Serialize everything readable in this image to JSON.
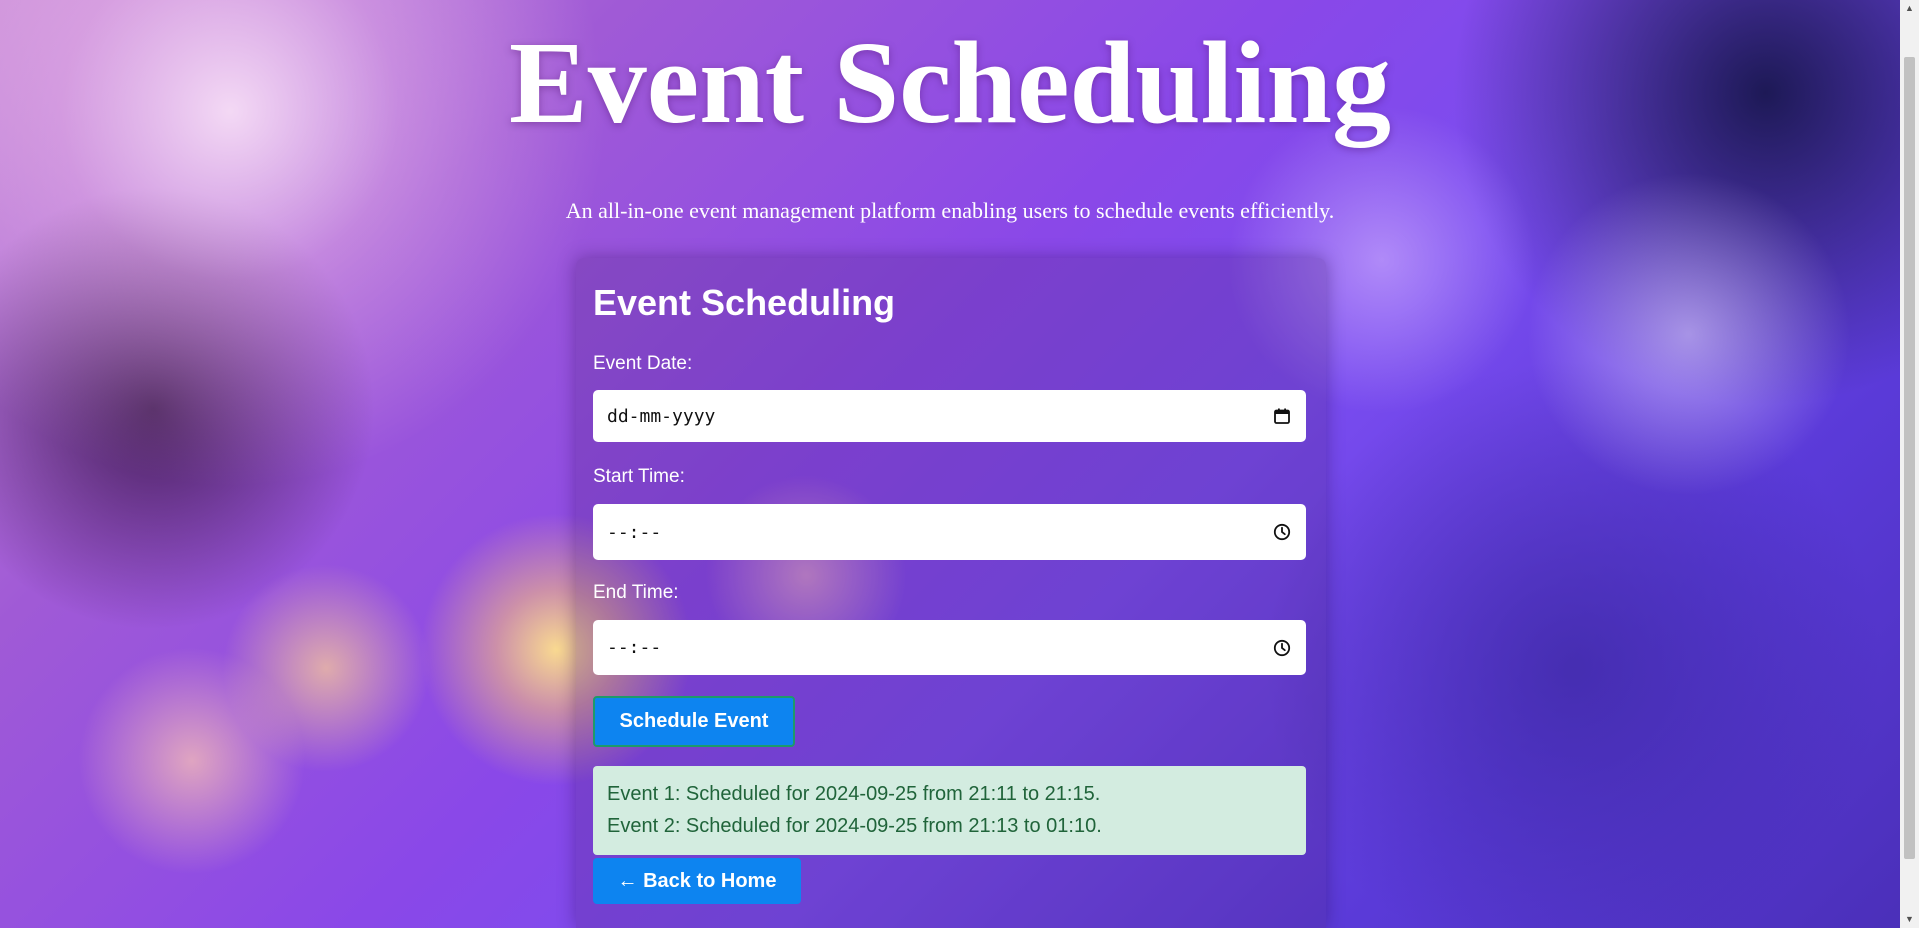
{
  "hero": {
    "title": "Event Scheduling",
    "subtitle": "An all-in-one event management platform enabling users to schedule events efficiently."
  },
  "form": {
    "title": "Event Scheduling",
    "event_date": {
      "label": "Event Date:",
      "placeholder": "dd-mm-yyyy",
      "icon": "calendar-icon"
    },
    "start_time": {
      "label": "Start Time:",
      "placeholder": "--:--",
      "icon": "clock-icon"
    },
    "end_time": {
      "label": "End Time:",
      "placeholder": "--:--",
      "icon": "clock-icon"
    },
    "submit_label": "Schedule Event"
  },
  "results": {
    "events": [
      "Event 1: Scheduled for 2024-09-25 from 21:11 to 21:15.",
      "Event 2: Scheduled for 2024-09-25 from 21:13 to 01:10."
    ],
    "background_color": "#d3ece0",
    "text_color": "#20643a"
  },
  "nav": {
    "back_label": "← Back to Home"
  },
  "colors": {
    "accent": "#0d84f0",
    "button_border": "#1e9a6a"
  }
}
